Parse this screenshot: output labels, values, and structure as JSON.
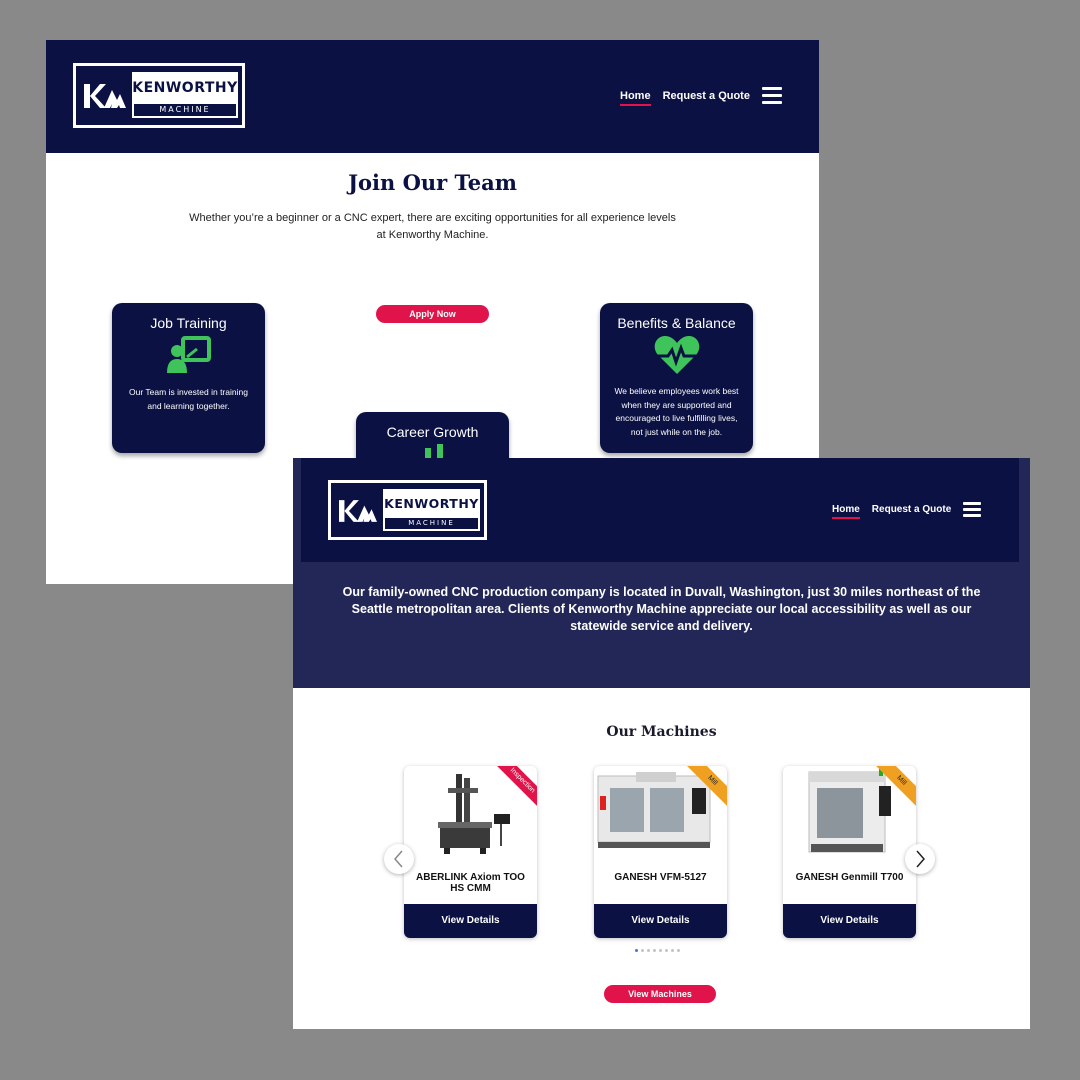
{
  "brand": {
    "name": "KENWORTHY",
    "sub": "MACHINE"
  },
  "nav": {
    "home": "Home",
    "quote": "Request a Quote"
  },
  "careers": {
    "title": "Join Our Team",
    "intro": "Whether you’re a beginner or a CNC expert, there are exciting opportunities for all experience levels at Kenworthy Machine.",
    "apply_label": "Apply Now",
    "cards": [
      {
        "title": "Job Training",
        "desc": "Our Team is invested in training and learning together."
      },
      {
        "title": "Career Growth",
        "desc": ""
      },
      {
        "title": "Benefits & Balance",
        "desc": "We believe employees work best when they are supported and encouraged to live fulfilling lives, not just while on the job."
      }
    ]
  },
  "about": {
    "text": "Our family-owned CNC production company is located in Duvall, Washington, just 30 miles northeast of the Seattle metropolitan area. Clients of Kenworthy Machine appreciate our local accessibility as well as our statewide service and delivery."
  },
  "machines": {
    "title": "Our Machines",
    "items": [
      {
        "name": "ABERLINK Axiom TOO HS CMM",
        "tag": "Inspection",
        "tag_color": "#e0134a",
        "button": "View Details"
      },
      {
        "name": "GANESH VFM-5127",
        "tag": "Mill",
        "tag_color": "#f0a020",
        "button": "View Details"
      },
      {
        "name": "GANESH Genmill T700",
        "tag": "Mill",
        "tag_color": "#f0a020",
        "button": "View Details"
      }
    ],
    "view_all": "View Machines"
  },
  "colors": {
    "navy": "#0b1142",
    "banner": "#222757",
    "accent": "#e0134a",
    "icon_green": "#3ec45a"
  }
}
